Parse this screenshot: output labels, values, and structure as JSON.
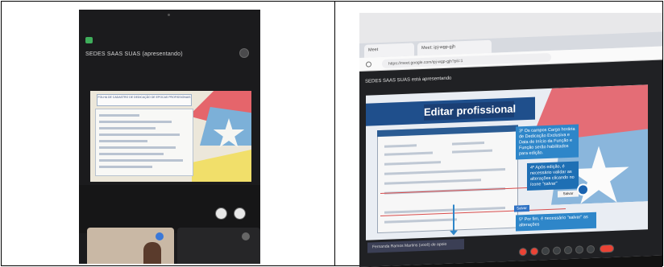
{
  "left_photo": {
    "presenter_label": "SEDES SAAS SUAS (apresentando)",
    "shared_form_heading": "FOLHA DE CADASTRO DE DEDICAÇÃO DE EPOCAS PROFISSIONAIS"
  },
  "right_photo": {
    "tabs": [
      "Meet",
      "Meet: ipj-wgp-gjh"
    ],
    "url": "https://meet.google.com/ipj-wgp-gjh?pli=1",
    "meeting_banner": "SEDES SAAS SUAS está apresentando",
    "slide": {
      "heading": "Editar profissional",
      "callouts": [
        "3º Os campos Carga horária de Dedicação Exclusiva e Data de Início da Função e Função serão habilitados para edição.",
        "4º Após edição, é necessário validar as alterações clicando no ícone \"salvar\"",
        "5º Por fim, é necessário \"salvar\" as alterações"
      ],
      "save_button": "Salvar",
      "save_small_label": "Salvar"
    },
    "presenter_bar": "Fernanda Ramos Martins (você) de apoio"
  },
  "colors": {
    "slide_blue": "#1f4f8c",
    "callout_blue": "#2e86c9",
    "flag_red": "#e46d76",
    "flag_blue": "#8ab6dc",
    "meet_bg": "#202124"
  }
}
